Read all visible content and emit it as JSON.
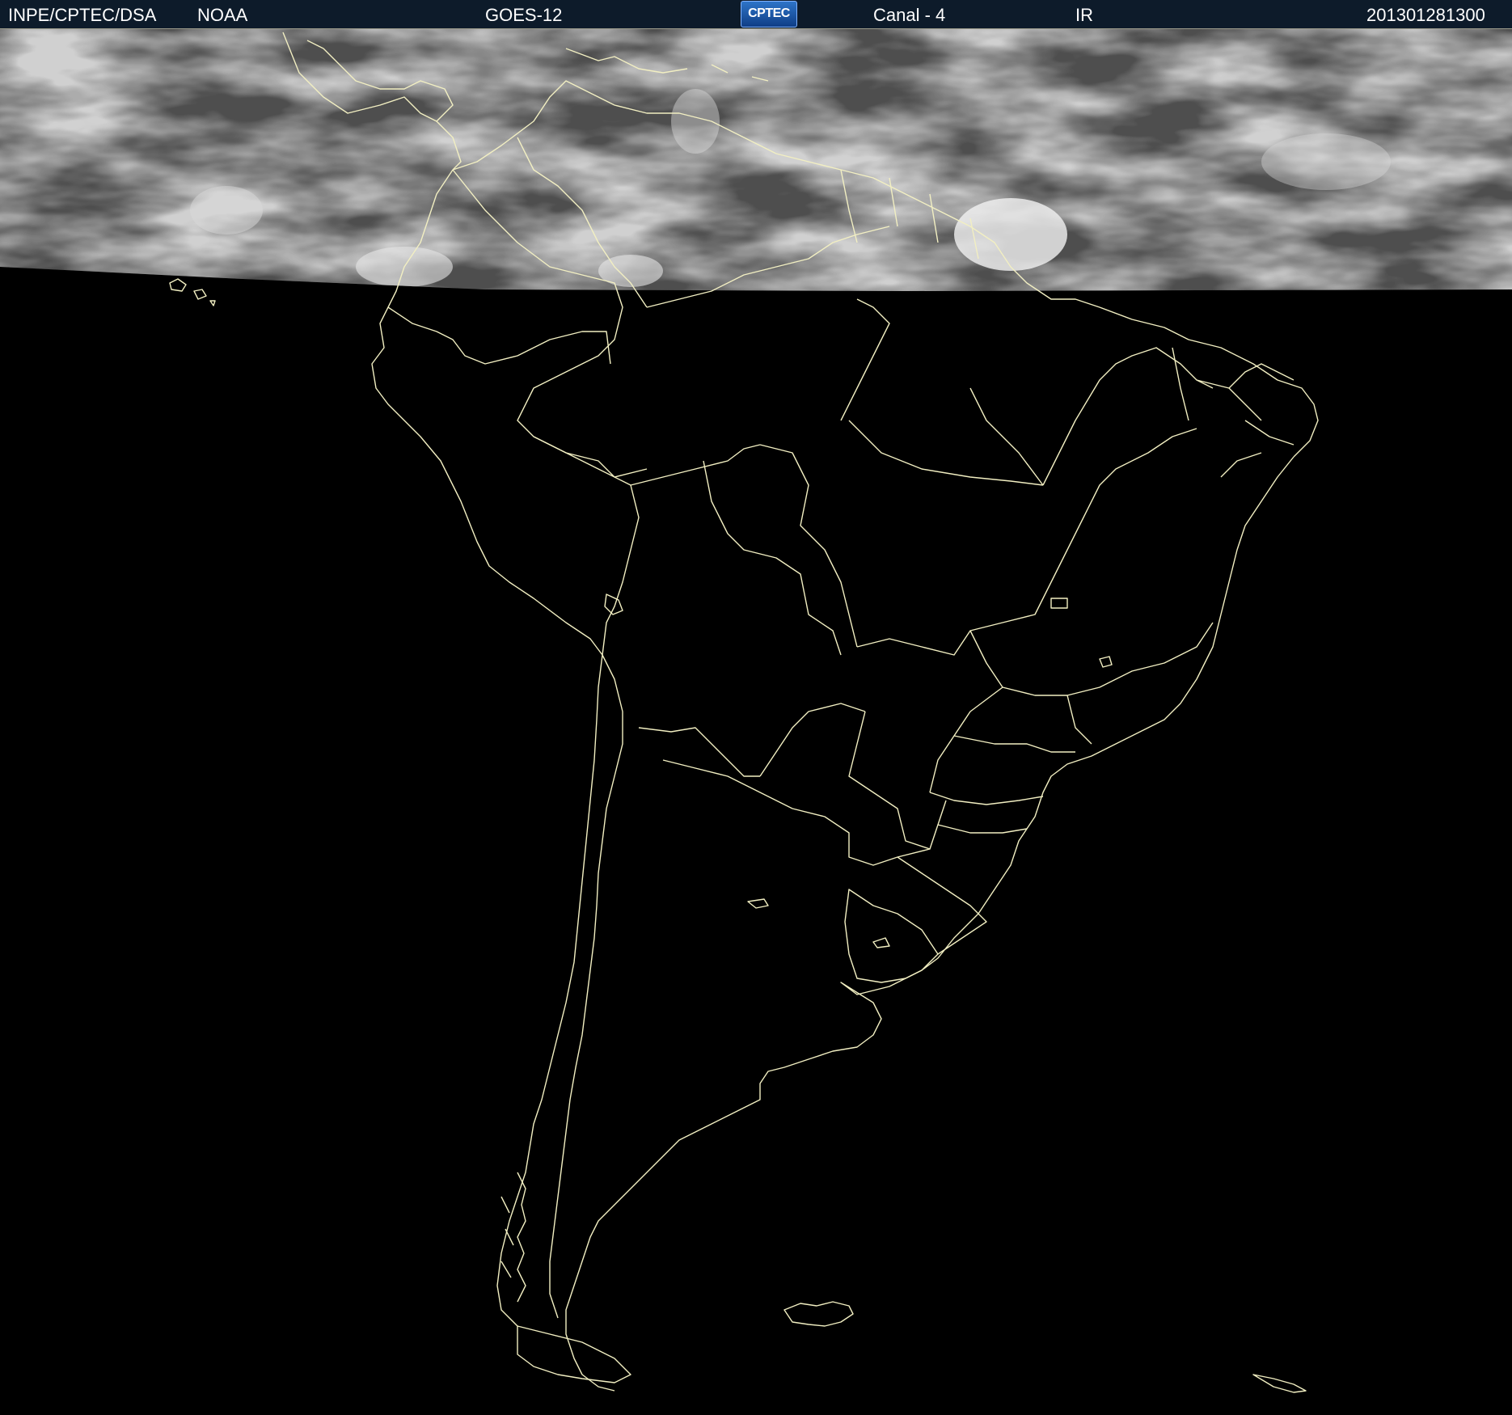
{
  "header": {
    "agency": "INPE/CPTEC/DSA",
    "source": "NOAA",
    "satellite": "GOES-12",
    "logo_text": "CPTEC",
    "channel": "Canal - 4",
    "band": "IR",
    "timestamp": "201301281300"
  },
  "colors": {
    "header_background": "#0d1b2a",
    "header_text": "#ffffff",
    "border_lines": "#f2efc2",
    "no_data_background": "#000000",
    "cloud_imagery_gray": "#5a5a5a"
  },
  "map": {
    "region": "South America",
    "imagery_coverage": "northern strip only (ocean/land north of ~3S); rest of frame black (no data)",
    "overlay": "country and state boundaries in pale yellow"
  }
}
